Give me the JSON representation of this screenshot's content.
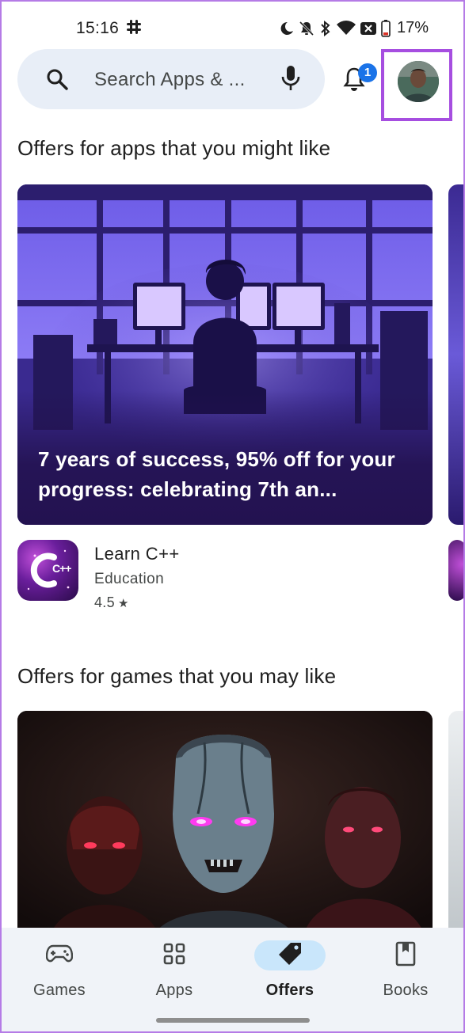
{
  "status_bar": {
    "time": "15:16",
    "battery": "17%"
  },
  "search": {
    "placeholder": "Search Apps & ..."
  },
  "notifications": {
    "count": "1"
  },
  "sections": [
    {
      "title": "Offers for apps that you might like",
      "banner_text": "7 years of success, 95% off for your progress: celebrating 7th an...",
      "app": {
        "icon_label": "C++",
        "name": "Learn C++",
        "category": "Education",
        "rating": "4.5"
      }
    },
    {
      "title": "Offers for games that you may like"
    }
  ],
  "bottom_nav": {
    "items": [
      {
        "label": "Games",
        "icon": "gamepad-icon"
      },
      {
        "label": "Apps",
        "icon": "apps-grid-icon"
      },
      {
        "label": "Offers",
        "icon": "offer-tag-icon",
        "active": true
      },
      {
        "label": "Books",
        "icon": "bookmark-icon"
      }
    ]
  },
  "colors": {
    "accent": "#1a73e8",
    "active_pill": "#c9e6fb",
    "search_bg": "#e8eef7",
    "highlight_border": "#a64ee0"
  }
}
